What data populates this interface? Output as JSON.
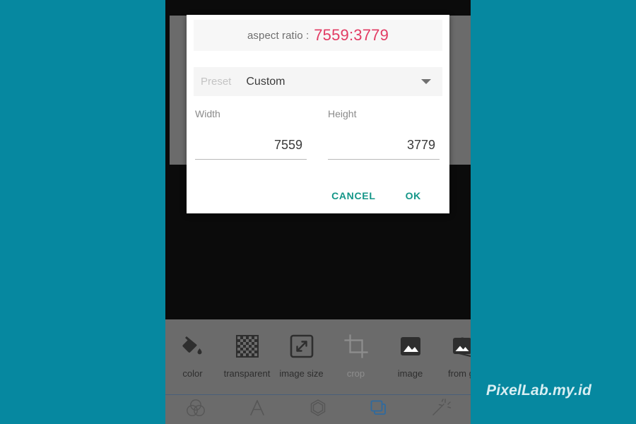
{
  "app": {
    "watermark": "PixelLab.my.id",
    "background_color": "#0688a0",
    "screen_background": "#0b0b0b",
    "toolbar_background": "#6b6b6b"
  },
  "dialog": {
    "aspect_ratio_label": "aspect ratio :",
    "aspect_ratio_value": "7559:3779",
    "aspect_ratio_color": "#e23b63",
    "preset_label": "Preset",
    "preset_value": "Custom",
    "preset_caret_icon": "chevron-down-icon",
    "width_label": "Width",
    "width_value": "7559",
    "height_label": "Height",
    "height_value": "3779",
    "cancel_label": "CANCEL",
    "ok_label": "OK",
    "action_color": "#149688"
  },
  "toolbar": {
    "items": [
      {
        "icon": "paint-bucket-icon",
        "label": "color",
        "disabled": false
      },
      {
        "icon": "checkerboard-icon",
        "label": "transparent",
        "disabled": false
      },
      {
        "icon": "resize-arrows-icon",
        "label": "image size",
        "disabled": false
      },
      {
        "icon": "crop-icon",
        "label": "crop",
        "disabled": true
      },
      {
        "icon": "picture-icon",
        "label": "image",
        "disabled": false
      },
      {
        "icon": "gallery-stack-icon",
        "label": "from gal",
        "disabled": false
      }
    ]
  },
  "bottom_nav": {
    "items": [
      {
        "icon": "venn-circles-icon",
        "active": false
      },
      {
        "icon": "text-a-icon",
        "active": false
      },
      {
        "icon": "hexagon-icon",
        "active": false
      },
      {
        "icon": "layers-icon",
        "active": true
      },
      {
        "icon": "magic-wand-icon",
        "active": false
      }
    ],
    "active_color": "#2f6a9e",
    "inactive_color": "#565656"
  }
}
